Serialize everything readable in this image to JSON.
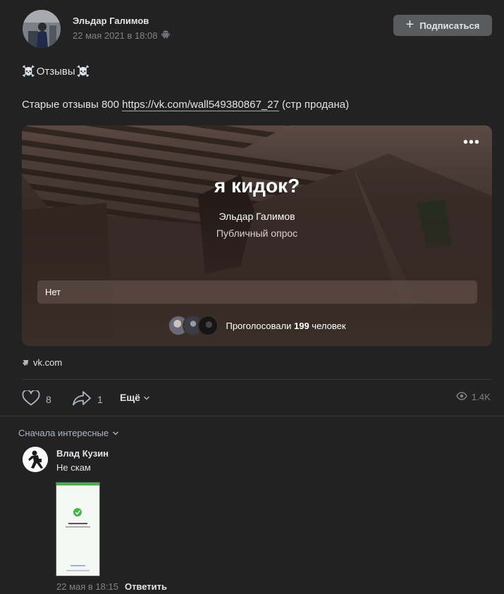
{
  "post": {
    "author": "Эльдар Галимов",
    "date": "22 мая 2021 в 18:08",
    "subscribe_label": "Подписаться",
    "heading": "Отзывы",
    "text_prefix": "Старые отзывы 800 ",
    "link_text": "https://vk.com/wall549380867_27",
    "text_suffix": " (стр продана)"
  },
  "poll": {
    "title": "я кидок?",
    "author": "Эльдар Галимов",
    "type": "Публичный опрос",
    "option": "Нет",
    "voted_prefix": "Проголосовали ",
    "voted_count": "199",
    "voted_suffix": " человек"
  },
  "source_link": "vk.com",
  "actions": {
    "likes": "8",
    "shares": "1",
    "more_label": "Ещё",
    "views": "1.4K"
  },
  "comments": {
    "sort_label": "Сначала интересные",
    "items": [
      {
        "author": "Влад Кузин",
        "text": "Не скам",
        "date": "22 мая в 18:15",
        "reply_label": "Ответить"
      }
    ]
  },
  "colors": {
    "background": "#222222",
    "button": "#5a5b5c",
    "text": "#e1e3e6",
    "muted": "#828282"
  },
  "icons": [
    "android-icon",
    "skull-icon",
    "plus-icon",
    "more-dots-icon",
    "link-arrow-icon",
    "like-icon",
    "share-icon",
    "chevron-down-icon",
    "eye-icon",
    "check-icon"
  ]
}
